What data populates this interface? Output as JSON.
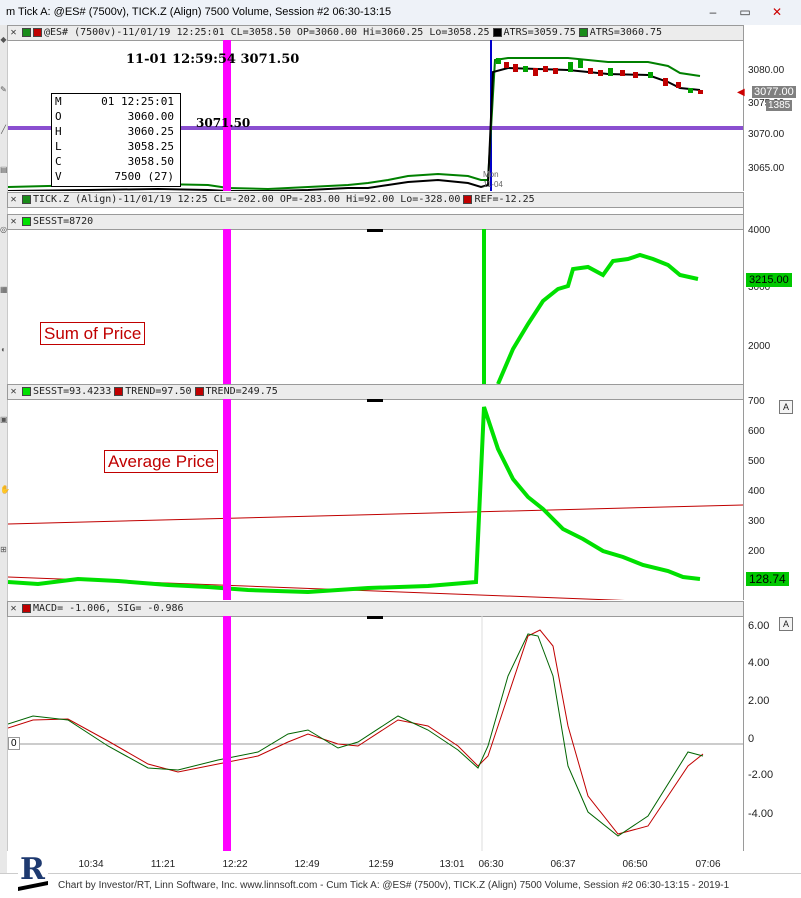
{
  "window": {
    "title": "m Tick A: @ES# (7500v), TICK.Z (Align) 7500 Volume, Session #2 06:30-13:15",
    "minimize": "–",
    "maximize": "▭",
    "close": "✕"
  },
  "pane_price": {
    "header": {
      "symbol_text": "@ES# (7500v)-11/01/19 12:25:01 CL=3058.50 OP=3060.00 Hi=3060.25 Lo=3058.25",
      "atrs1": "ATRS=3059.75",
      "atrs2": "ATRS=3060.75"
    },
    "cursor_text": "11-01 12:59:54  3071.50",
    "hline_label": "3071.50",
    "mon_label": "Mon",
    "date_label": "11-04",
    "axis_ticks": [
      "3080.00",
      "3075.00",
      "3070.00",
      "3065.00"
    ],
    "last_price": "3077.00",
    "last_sub": "1385",
    "ohlc": {
      "rows": [
        {
          "k": "M",
          "v": "01 12:25:01"
        },
        {
          "k": "O",
          "v": "3060.00"
        },
        {
          "k": "H",
          "v": "3060.25"
        },
        {
          "k": "L",
          "v": "3058.25"
        },
        {
          "k": "C",
          "v": "3058.50"
        },
        {
          "k": "V",
          "v": "7500 (27)"
        }
      ]
    }
  },
  "pane_tick": {
    "header": {
      "text": "TICK.Z (Align)-11/01/19 12:25 CL=-202.00 OP=-283.00 Hi=92.00 Lo=-328.00",
      "ref": "REF=-12.25"
    }
  },
  "pane_sum": {
    "header": {
      "sesst": "SESST=8720"
    },
    "label": "Sum of Price",
    "axis_ticks": [
      "4000",
      "3000",
      "2000"
    ],
    "last_value": "3215.00"
  },
  "pane_avg": {
    "header": {
      "sesst": "SESST=93.4233",
      "trend1": "TREND=97.50",
      "trend2": "TREND=249.75"
    },
    "label": "Average Price",
    "axis_ticks": [
      "700",
      "600",
      "500",
      "400",
      "300",
      "200"
    ],
    "last_value": "128.74"
  },
  "pane_macd": {
    "header": {
      "text": "MACD=  -1.006, SIG=  -0.986"
    },
    "zero_label": "0",
    "axis_ticks": [
      "6.00",
      "4.00",
      "2.00",
      "0",
      "-2.00",
      "-4.00"
    ]
  },
  "x_axis": [
    "10:34",
    "11:21",
    "12:22",
    "12:49",
    "12:59",
    "13:01",
    "06:30",
    "06:37",
    "06:50",
    "07:06"
  ],
  "footer": "Chart by Investor/RT, Linn Software, Inc. www.linnsoft.com - Cum Tick A: @ES# (7500v), TICK.Z (Align) 7500 Volume, Session #2 06:30-13:15 - 2019-1",
  "scroll_a": "A",
  "colors": {
    "magenta": "#ff00ff",
    "green": "#00e000",
    "red": "#c00000",
    "navy": "#0000cc",
    "purple": "#8a4fd0"
  }
}
